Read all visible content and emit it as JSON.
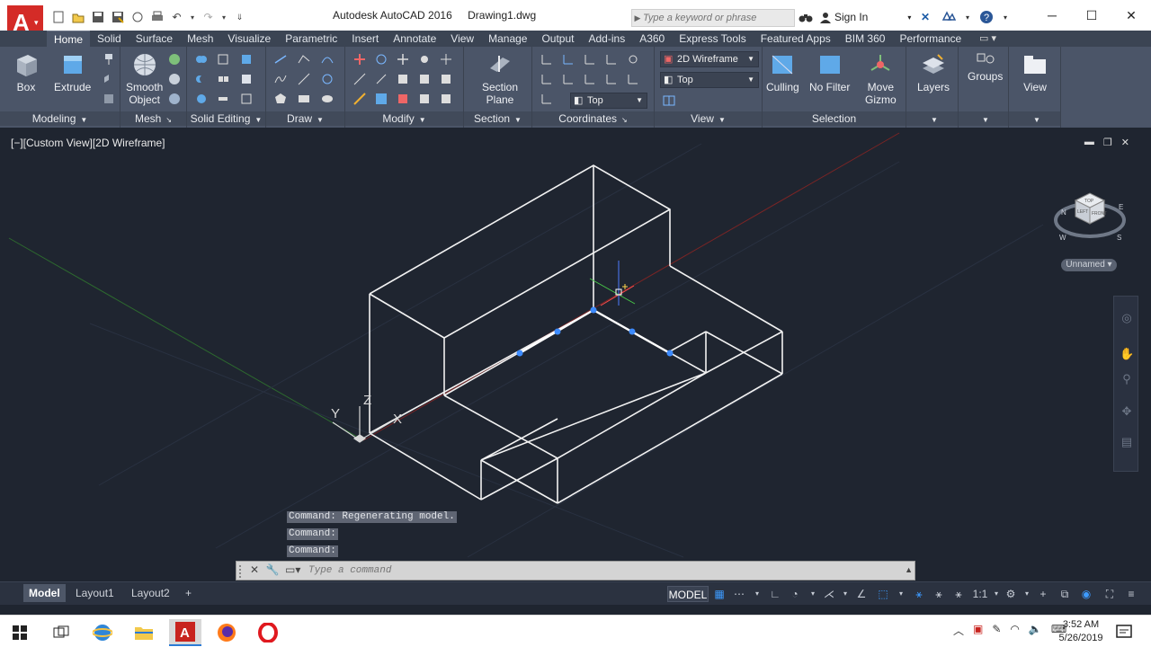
{
  "window": {
    "app_title": "Autodesk AutoCAD 2016",
    "file_name": "Drawing1.dwg",
    "search_placeholder": "Type a keyword or phrase",
    "sign_in": "Sign In"
  },
  "ribbon_tabs": [
    "Home",
    "Solid",
    "Surface",
    "Mesh",
    "Visualize",
    "Parametric",
    "Insert",
    "Annotate",
    "View",
    "Manage",
    "Output",
    "Add-ins",
    "A360",
    "Express Tools",
    "Featured Apps",
    "BIM 360",
    "Performance"
  ],
  "ribbon": {
    "big_buttons": {
      "box": "Box",
      "extrude": "Extrude",
      "smooth_object_1": "Smooth",
      "smooth_object_2": "Object",
      "section_plane_1": "Section",
      "section_plane_2": "Plane",
      "culling": "Culling",
      "no_filter": "No Filter",
      "move_gizmo_1": "Move",
      "move_gizmo_2": "Gizmo",
      "layers": "Layers",
      "groups": "Groups",
      "view": "View"
    },
    "panels": {
      "modeling": "Modeling",
      "mesh": "Mesh",
      "solid_editing": "Solid Editing",
      "draw": "Draw",
      "modify": "Modify",
      "section": "Section",
      "coordinates": "Coordinates",
      "view": "View",
      "selection": "Selection"
    },
    "visual_style": "2D Wireframe",
    "view_preset": "Top",
    "ucs_preset": "Top"
  },
  "viewport": {
    "label": "[−][Custom View][2D Wireframe]",
    "viewcube_faces": [
      "TOP",
      "LEFT",
      "FRONT"
    ],
    "compass": [
      "N",
      "W",
      "S",
      "E"
    ],
    "ucs_labels": [
      "Y",
      "Z",
      "X"
    ],
    "wcs_name": "Unnamed"
  },
  "command": {
    "history": [
      "Command:  Regenerating model.",
      "Command:",
      "Command:"
    ],
    "placeholder": "Type a command"
  },
  "layouts": [
    "Model",
    "Layout1",
    "Layout2"
  ],
  "status": {
    "model": "MODEL",
    "scale": "1:1"
  },
  "taskbar": {
    "time": "3:52 AM",
    "date": "5/26/2019"
  }
}
